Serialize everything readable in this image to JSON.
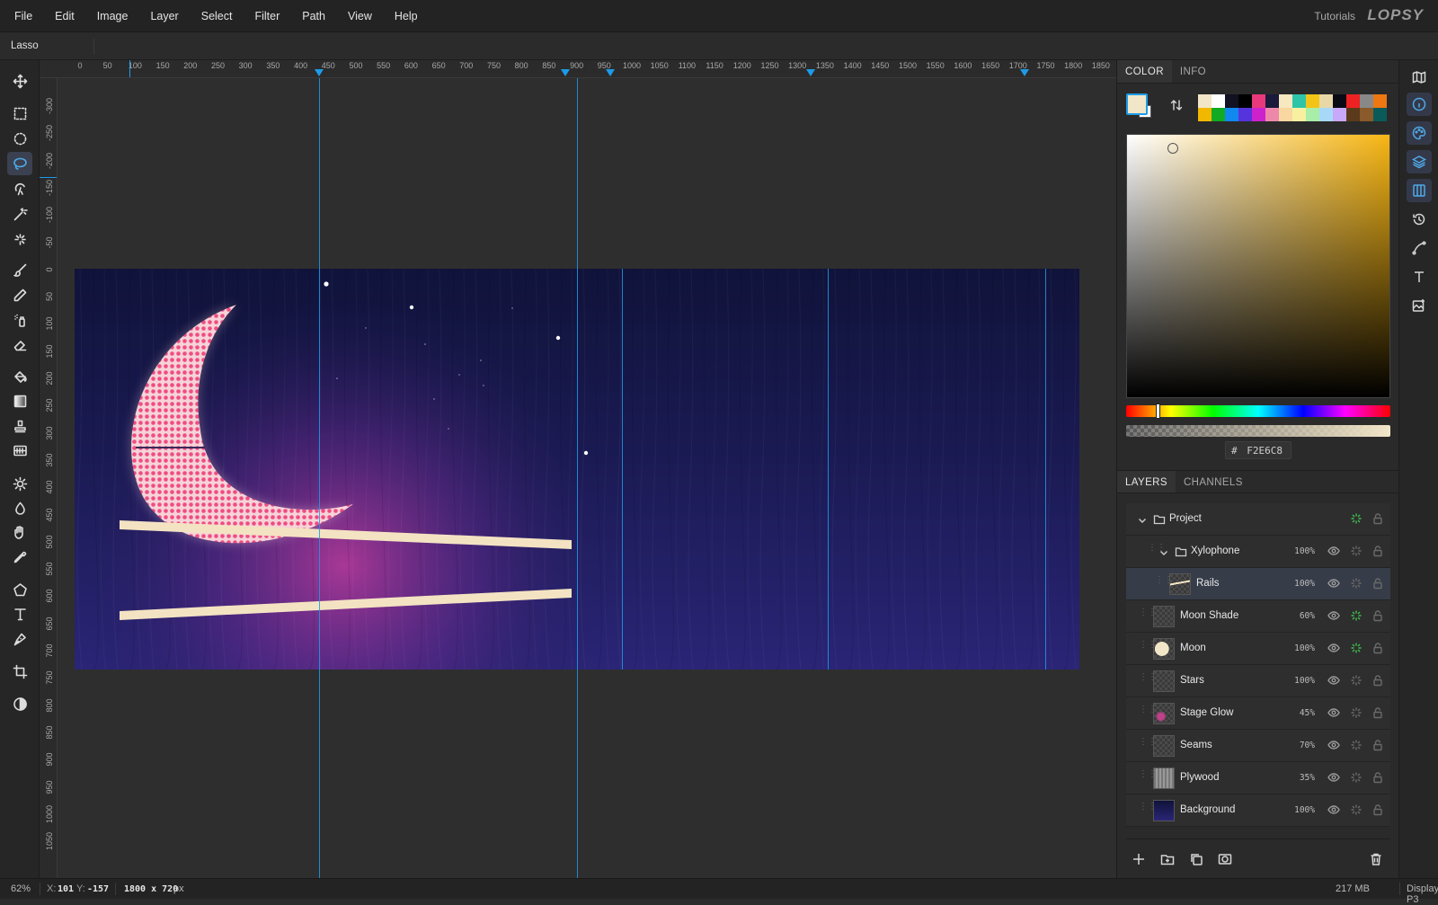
{
  "menu": {
    "items": [
      "File",
      "Edit",
      "Image",
      "Layer",
      "Select",
      "Filter",
      "Path",
      "View",
      "Help"
    ],
    "tutorials": "Tutorials",
    "logo": "LOPSY"
  },
  "options_bar": {
    "tool_name": "Lasso"
  },
  "tools": [
    {
      "name": "move-tool-icon"
    },
    {
      "name": "rect-select-icon"
    },
    {
      "name": "ellipse-select-icon"
    },
    {
      "name": "lasso-icon",
      "active": true
    },
    {
      "name": "magnet-lasso-icon"
    },
    {
      "name": "magic-wand-icon"
    },
    {
      "name": "quick-select-icon"
    },
    {
      "name": "brush-icon"
    },
    {
      "name": "pencil-icon"
    },
    {
      "name": "spray-icon"
    },
    {
      "name": "eraser-icon"
    },
    {
      "name": "fill-bucket-icon"
    },
    {
      "name": "gradient-icon"
    },
    {
      "name": "stamp-icon"
    },
    {
      "name": "pattern-icon"
    },
    {
      "name": "dodge-icon"
    },
    {
      "name": "blur-icon"
    },
    {
      "name": "smudge-icon"
    },
    {
      "name": "eyedropper-icon"
    },
    {
      "name": "polygon-icon"
    },
    {
      "name": "text-tool-icon"
    },
    {
      "name": "pen-icon"
    },
    {
      "name": "crop-icon"
    },
    {
      "name": "contrast-icon"
    }
  ],
  "ruler": {
    "top": [
      "0",
      "50",
      "100",
      "150",
      "200",
      "250",
      "300",
      "350",
      "400",
      "450",
      "500",
      "550",
      "600",
      "650",
      "700",
      "750",
      "800",
      "850",
      "900",
      "950",
      "1000",
      "1050",
      "1100",
      "1150",
      "1200",
      "1250",
      "1300",
      "1350",
      "1400",
      "1450",
      "1500",
      "1550",
      "1600",
      "1650",
      "1700",
      "1750",
      "1800",
      "1850"
    ],
    "left": [
      "-300",
      "-250",
      "-200",
      "-150",
      "-100",
      "-50",
      "0",
      "50",
      "100",
      "150",
      "200",
      "250",
      "300",
      "350",
      "400",
      "450",
      "500",
      "550",
      "600",
      "650",
      "700",
      "750",
      "800",
      "850",
      "900",
      "950",
      "1000",
      "1050"
    ]
  },
  "color_panel": {
    "tabs": [
      "COLOR",
      "INFO"
    ],
    "foreground": "#f2e6c8",
    "background": "#ffffff",
    "hex_prefix": "#",
    "hex_value": "F2E6C8",
    "palette": [
      "#f2e6c8",
      "#ffffff",
      "#111122",
      "#000000",
      "#e8397a",
      "#1a1a3a",
      "#f7e8c0",
      "#2ec4a8",
      "#f2c418",
      "#e8d8a8",
      "#0a0a14",
      "#ee2222",
      "#888888",
      "#ee7711",
      "#f2b800",
      "#11aa22",
      "#1188ee",
      "#5533dd",
      "#cc22cc",
      "#ee88aa",
      "#f8d8a0",
      "#f8f0a0",
      "#a8eea8",
      "#a8d8f8",
      "#c8a8f8",
      "#5a3a1a",
      "#8a5a2a",
      "#0a5a5a"
    ]
  },
  "layers_panel": {
    "tabs": [
      "LAYERS",
      "CHANNELS"
    ],
    "layers": [
      {
        "name": "Project",
        "opacity": "",
        "indent": 0,
        "group": true,
        "fx_on": true,
        "selected": false
      },
      {
        "name": "Xylophone",
        "opacity": "100%",
        "indent": 1,
        "group": true,
        "fx_on": false,
        "selected": false
      },
      {
        "name": "Rails",
        "opacity": "100%",
        "indent": 2,
        "group": false,
        "fx_on": false,
        "selected": true
      },
      {
        "name": "Moon Shade",
        "opacity": "60%",
        "indent": 0,
        "group": false,
        "fx_on": true,
        "selected": false
      },
      {
        "name": "Moon",
        "opacity": "100%",
        "indent": 0,
        "group": false,
        "fx_on": true,
        "selected": false
      },
      {
        "name": "Stars",
        "opacity": "100%",
        "indent": 0,
        "group": false,
        "fx_on": false,
        "selected": false
      },
      {
        "name": "Stage Glow",
        "opacity": "45%",
        "indent": 0,
        "group": false,
        "fx_on": false,
        "selected": false
      },
      {
        "name": "Seams",
        "opacity": "70%",
        "indent": 0,
        "group": false,
        "fx_on": false,
        "selected": false
      },
      {
        "name": "Plywood",
        "opacity": "35%",
        "indent": 0,
        "group": false,
        "fx_on": false,
        "selected": false
      },
      {
        "name": "Background",
        "opacity": "100%",
        "indent": 0,
        "group": false,
        "fx_on": false,
        "selected": false
      }
    ]
  },
  "status": {
    "zoom": "62%",
    "x_label": "X:",
    "x_value": "101",
    "y_label": "Y:",
    "y_value": "-157",
    "doc_size": "1800 x 720",
    "doc_unit": "px",
    "memory": "217 MB",
    "profile": "Display P3"
  },
  "colors": {
    "accent": "#1e9be8",
    "fx_active": "#3fbf4f"
  }
}
